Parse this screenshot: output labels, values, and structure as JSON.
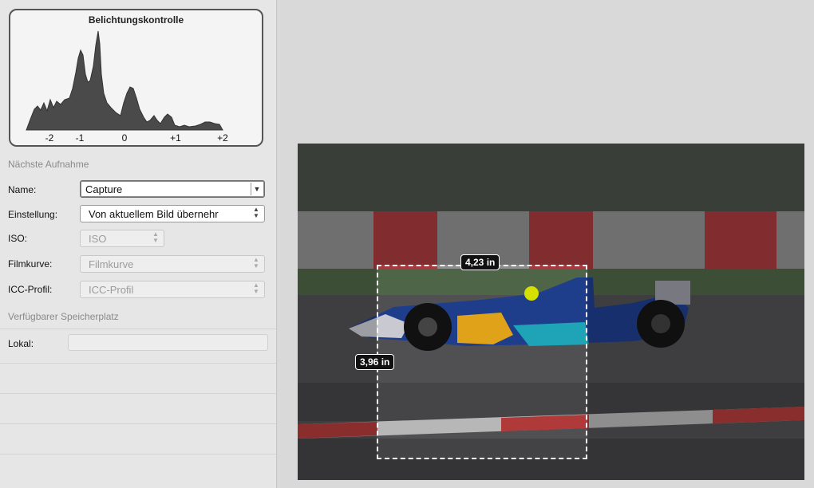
{
  "histogram": {
    "title": "Belichtungskontrolle",
    "ticks": [
      "-2",
      "-1",
      "0",
      "+1",
      "+2"
    ]
  },
  "next_capture": {
    "section_title": "Nächste Aufnahme",
    "name_label": "Name:",
    "name_value": "Capture",
    "setting_label": "Einstellung:",
    "setting_value": "Von aktuellem Bild übernehr",
    "iso_label": "ISO:",
    "iso_value": "ISO",
    "film_curve_label": "Filmkurve:",
    "film_curve_value": "Filmkurve",
    "icc_label": "ICC-Profil:",
    "icc_value": "ICC-Profil"
  },
  "storage": {
    "section_title": "Verfügbarer Speicherplatz",
    "local_label": "Lokal:",
    "local_value": ""
  },
  "preview": {
    "width_label": "4,23 in",
    "height_label": "3,96 in"
  },
  "colors": {
    "panel_bg": "#e6e6e6",
    "crop_border": "#ffffff",
    "curb_red": "#b03a3a"
  }
}
